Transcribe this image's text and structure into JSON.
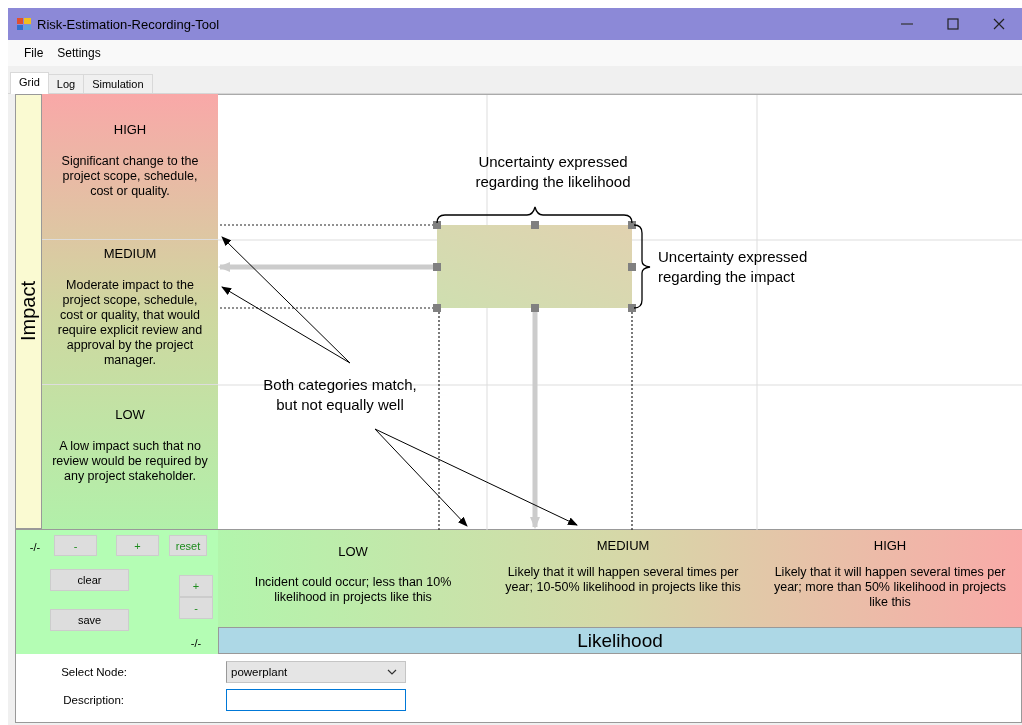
{
  "window": {
    "title": "Risk-Estimation-Recording-Tool"
  },
  "menu": [
    "File",
    "Settings"
  ],
  "tabs": [
    {
      "label": "Grid",
      "selected": true
    },
    {
      "label": "Log",
      "selected": false
    },
    {
      "label": "Simulation",
      "selected": false
    }
  ],
  "impact_axis": {
    "label": "Impact"
  },
  "impact_levels": [
    {
      "title": "HIGH",
      "description": "Significant change to the project scope, schedule, cost or quality."
    },
    {
      "title": "MEDIUM",
      "description": "Moderate impact to the project scope, schedule, cost or quality, that would require explicit review and approval by the project manager."
    },
    {
      "title": "LOW",
      "description": "A low impact such that no review would be required by any project stakeholder."
    }
  ],
  "annotations": [
    {
      "kind": "likelihood_note",
      "text": "Uncertainty expressed\nregarding the likelihood"
    },
    {
      "kind": "impact_note",
      "text": "Uncertainty expressed\nregarding the impact"
    },
    {
      "kind": "match_note",
      "text": "Both categories match,\nbut not equally well"
    }
  ],
  "controls": {
    "top_label": "-/-",
    "top_buttons": [
      "-",
      "+",
      "reset"
    ],
    "actions": [
      "clear",
      "save"
    ],
    "side_buttons": [
      "+",
      "-"
    ],
    "side_label": "-/-"
  },
  "likelihood_levels": [
    {
      "title": "LOW",
      "description": "Incident could occur; less than 10% likelihood in projects like this"
    },
    {
      "title": "MEDIUM",
      "description": "Likely that it will happen several times per year; 10-50% likelihood in projects like this"
    },
    {
      "title": "HIGH",
      "description": "Likely that it will happen several times per year; more than 50% likelihood in projects like this"
    }
  ],
  "likelihood_axis": {
    "label": "Likelihood"
  },
  "form": {
    "node_label": "Select Node:",
    "node_value": "powerplant",
    "description_label": "Description:",
    "description_focused": true
  }
}
